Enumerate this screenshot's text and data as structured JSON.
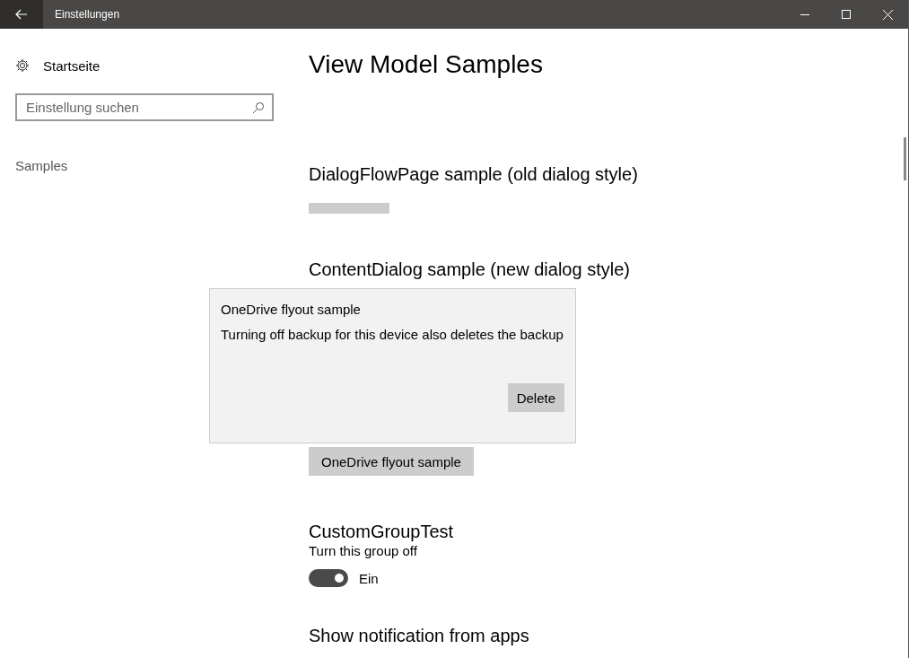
{
  "window": {
    "title": "Einstellungen"
  },
  "sidebar": {
    "home": "Startseite",
    "search": {
      "placeholder": "Einstellung suchen"
    },
    "items": [
      "Samples"
    ]
  },
  "page": {
    "title": "View Model Samples",
    "sections": [
      {
        "kind": "blank_button",
        "title": "DialogFlowPage sample (old dialog style)"
      },
      {
        "kind": "flyout_button",
        "title": "ContentDialog sample (new dialog style)",
        "button": "OneDrive flyout sample"
      },
      {
        "kind": "toggle",
        "title": "CustomGroupTest",
        "description": "Turn this group off",
        "on": true,
        "state_label": "Ein"
      },
      {
        "kind": "heading",
        "title": "Show notification from apps"
      }
    ]
  },
  "flyout": {
    "title": "OneDrive flyout sample",
    "message": "Turning off backup for this device also deletes the backup",
    "button": "Delete"
  }
}
